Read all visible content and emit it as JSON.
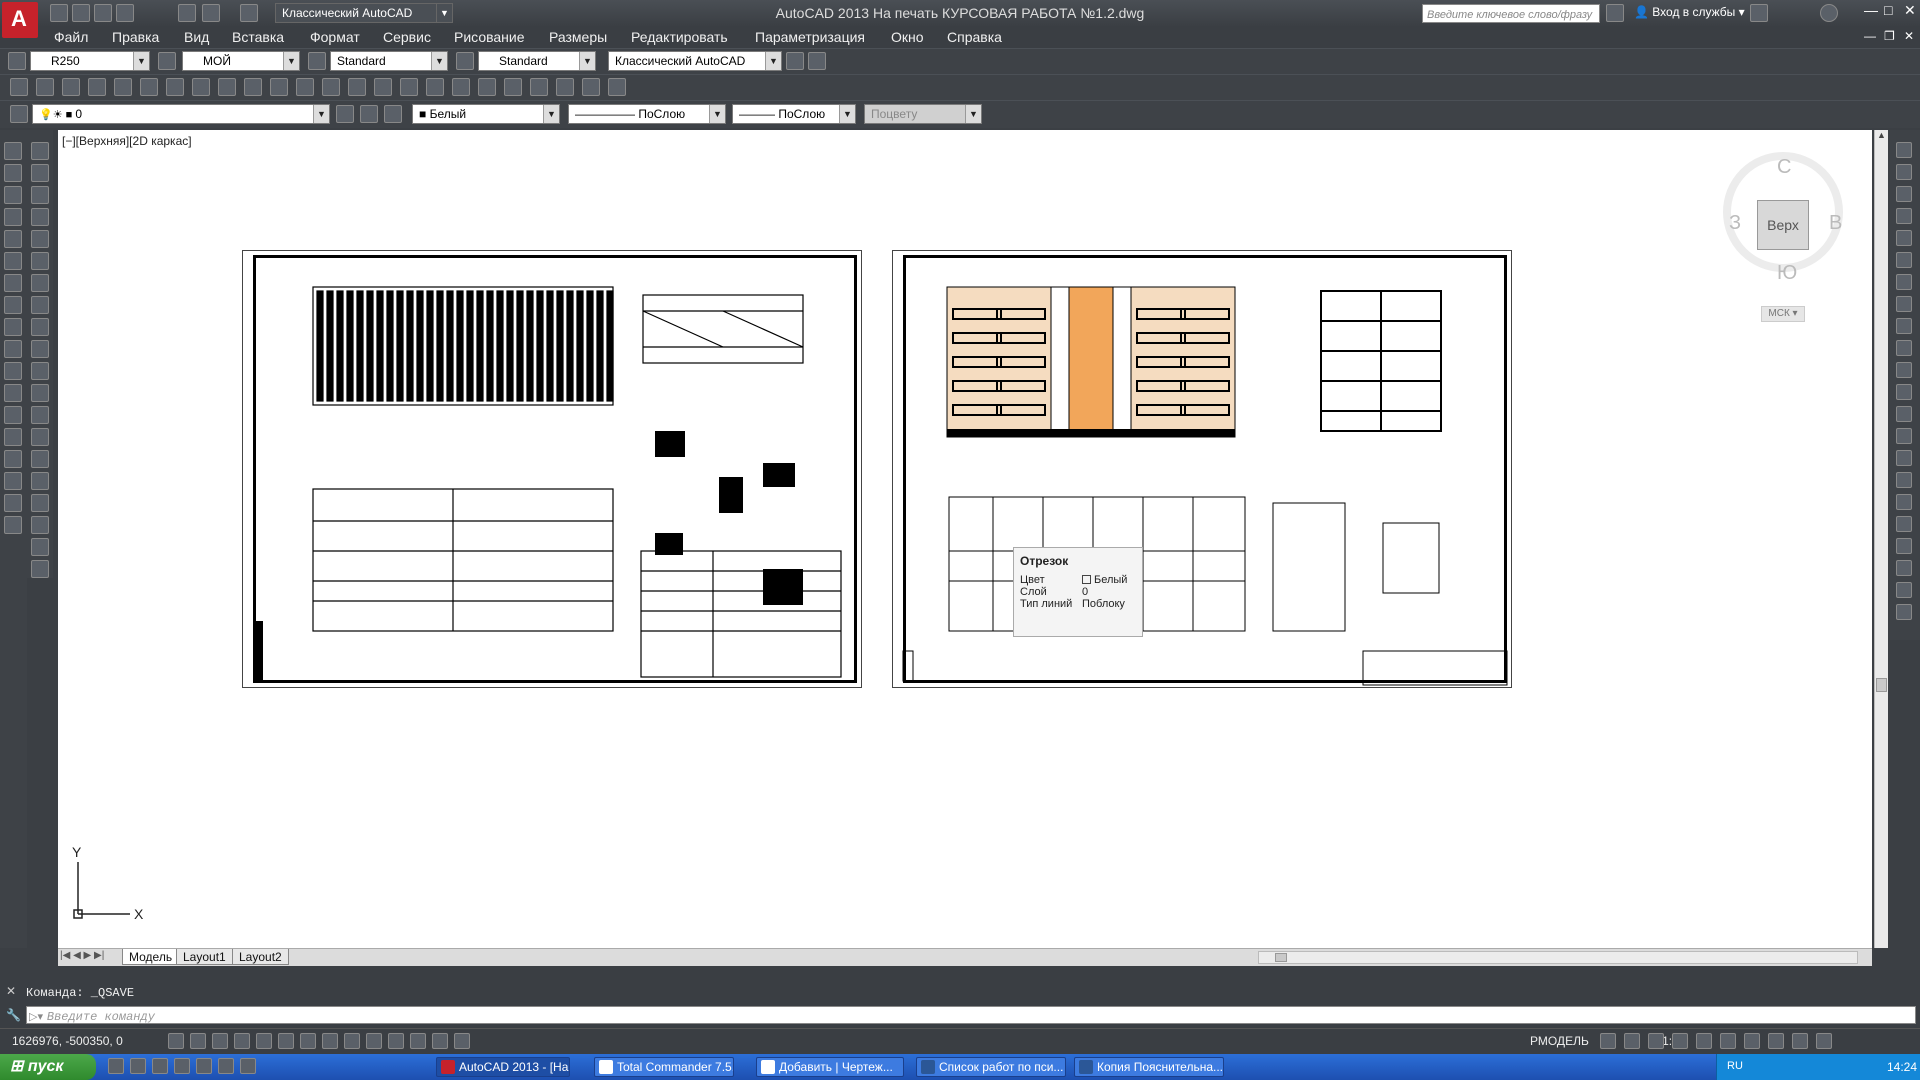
{
  "app": {
    "title": "AutoCAD 2013    На печать КУРСОВАЯ РАБОТА №1.2.dwg",
    "workspace": "Классический AutoCAD",
    "search_placeholder": "Введите ключевое слово/фразу",
    "signin": "Вход в службы"
  },
  "menu": [
    "Файл",
    "Правка",
    "Вид",
    "Вставка",
    "Формат",
    "Сервис",
    "Рисование",
    "Размеры",
    "Редактировать",
    "Параметризация",
    "Окно",
    "Справка"
  ],
  "styles": {
    "text_style": "R250",
    "dim_style": "МОЙ",
    "table_style": "Standard",
    "mleader_style": "Standard",
    "workspace": "Классический AutoCAD"
  },
  "layers": {
    "layer": "0",
    "color": "Белый",
    "linetype": "ПоСлою",
    "lineweight": "ПоСлою",
    "plotstyle": "Поцвету"
  },
  "viewport": {
    "label": "[−][Верхняя][2D каркас]",
    "viewcube": {
      "top": "Верх",
      "north": "С",
      "south": "Ю",
      "west": "З",
      "east": "В",
      "ucs": "МСК"
    },
    "ucs_x": "X",
    "ucs_y": "Y"
  },
  "tooltip": {
    "title": "Отрезок",
    "rows": [
      {
        "label": "Цвет",
        "value": "Белый"
      },
      {
        "label": "Слой",
        "value": "0"
      },
      {
        "label": "Тип линий",
        "value": "Поблоку"
      }
    ]
  },
  "layout_tabs": [
    "Модель",
    "Layout1",
    "Layout2"
  ],
  "command": {
    "history": "Команда:  _QSAVE",
    "prompt": "Введите команду"
  },
  "status": {
    "coords": "1626976, -500350, 0",
    "model": "РМОДЕЛЬ",
    "scale": "1:1"
  },
  "taskbar": {
    "start": "пуск",
    "tasks": [
      "AutoCAD 2013 - [На ...",
      "Total Commander 7.5...",
      "Добавить | Чертеж...",
      "Список работ по пси...",
      "Копия Пояснительна..."
    ],
    "lang": "RU",
    "time": "14:24"
  }
}
